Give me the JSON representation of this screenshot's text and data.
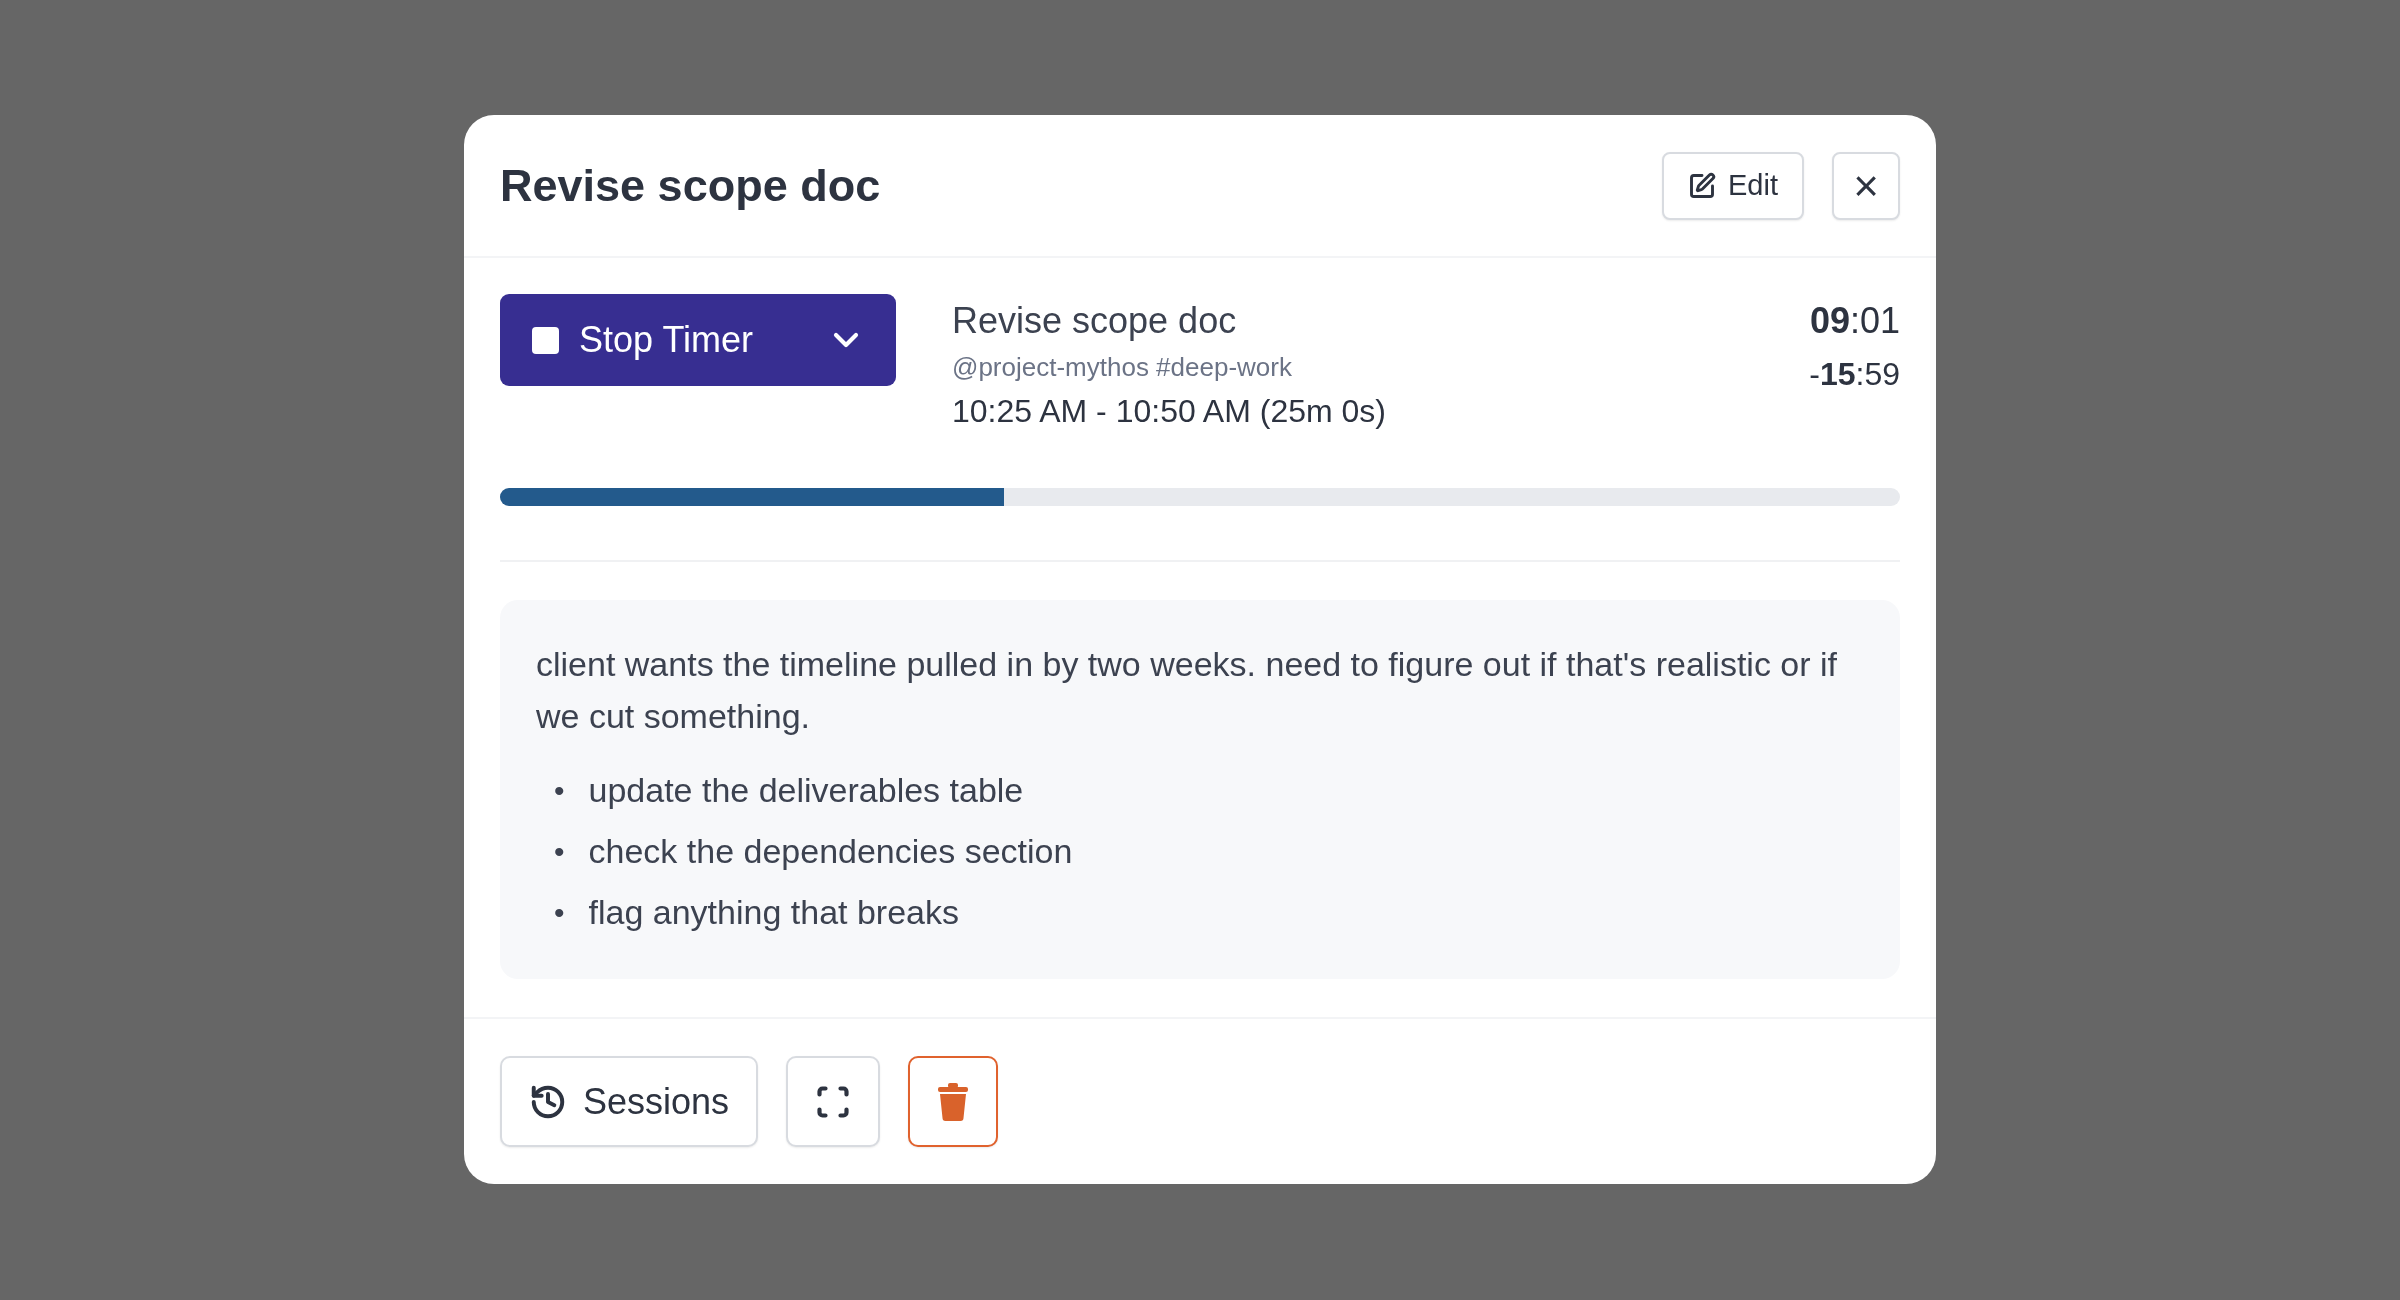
{
  "dialog": {
    "title": "Revise scope doc",
    "header_buttons": [
      {
        "kind": "edit",
        "label": "Edit"
      },
      {
        "kind": "close",
        "label": "×"
      }
    ]
  },
  "timer": {
    "button_label": "Stop Timer",
    "entry_title": "Revise scope doc",
    "tags": "@project-mythos #deep-work",
    "time_range": "10:25 AM - 10:50 AM (25m 0s)",
    "elapsed": "**09**:01",
    "remaining": "-**15**:59",
    "progress": {
      "level": 0.36
    }
  },
  "notes": {
    "paragraph": "client wants the timeline pulled in by two weeks. need to figure out if that's realistic or if we cut something.",
    "bullets": [
      {
        "marker": "•",
        "text": "update the deliverables table"
      },
      {
        "marker": "•",
        "text": "check the dependencies section"
      },
      {
        "marker": "•",
        "text": "flag anything that breaks"
      }
    ]
  },
  "footer_buttons": [
    {
      "kind": "sessions",
      "label": "Sessions"
    },
    {
      "kind": "expand"
    },
    {
      "kind": "delete"
    }
  ]
}
